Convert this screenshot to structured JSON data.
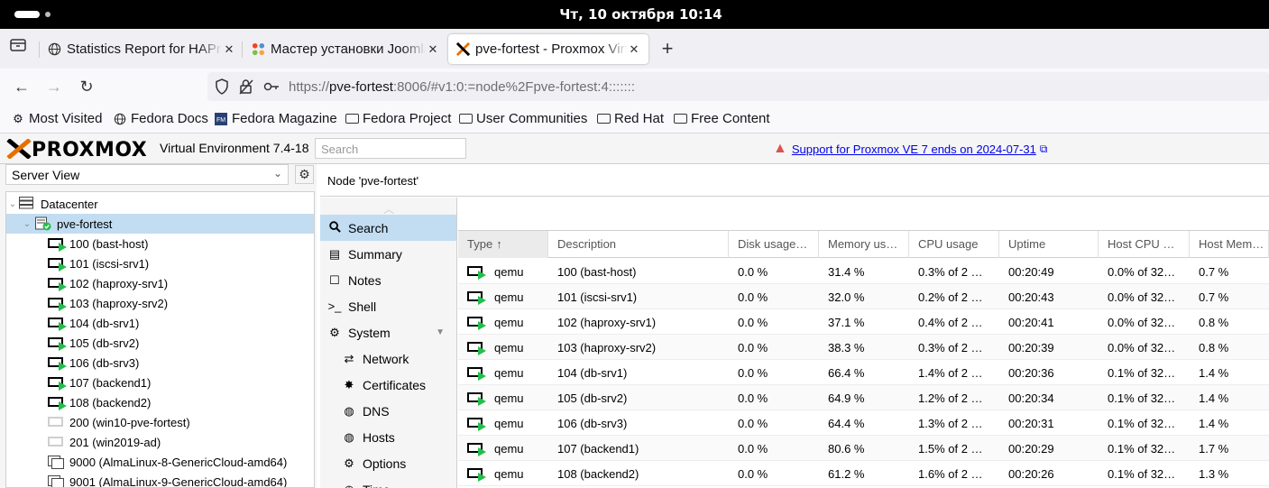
{
  "os": {
    "datetime": "Чт, 10 октября  10:14"
  },
  "browser": {
    "tabs": [
      {
        "title": "Statistics Report for HAProxy",
        "icon": "globe-icon"
      },
      {
        "title": "Мастер установки Joomla!",
        "icon": "joomla-icon"
      },
      {
        "title": "pve-fortest - Proxmox Virtual Environment",
        "icon": "proxmox-icon",
        "active": true
      }
    ],
    "url_prefix": "https://",
    "url_host": "pve-fortest",
    "url_rest": ":8006/#v1:0:=node%2Fpve-fortest:4:::::::",
    "bookmarks": [
      {
        "label": "Most Visited",
        "icon": "gear-icon"
      },
      {
        "label": "Fedora Docs",
        "icon": "globe-icon"
      },
      {
        "label": "Fedora Magazine",
        "icon": "fedora-magazine-icon"
      },
      {
        "label": "Fedora Project",
        "icon": "folder-icon"
      },
      {
        "label": "User Communities",
        "icon": "folder-icon"
      },
      {
        "label": "Red Hat",
        "icon": "folder-icon"
      },
      {
        "label": "Free Content",
        "icon": "folder-icon"
      }
    ]
  },
  "pve": {
    "logo": "PROXMOX",
    "version": "Virtual Environment 7.4-18",
    "search_placeholder": "Search",
    "warning": "Support for Proxmox VE 7 ends on 2024-07-31",
    "view_selector": "Server View",
    "tree": {
      "datacenter": "Datacenter",
      "node": "pve-fortest",
      "vms": [
        {
          "label": "100 (bast-host)",
          "state": "running"
        },
        {
          "label": "101 (iscsi-srv1)",
          "state": "running"
        },
        {
          "label": "102 (haproxy-srv1)",
          "state": "running"
        },
        {
          "label": "103 (haproxy-srv2)",
          "state": "running"
        },
        {
          "label": "104 (db-srv1)",
          "state": "running"
        },
        {
          "label": "105 (db-srv2)",
          "state": "running"
        },
        {
          "label": "106 (db-srv3)",
          "state": "running"
        },
        {
          "label": "107 (backend1)",
          "state": "running"
        },
        {
          "label": "108 (backend2)",
          "state": "running"
        },
        {
          "label": "200 (win10-pve-fortest)",
          "state": "stopped"
        },
        {
          "label": "201 (win2019-ad)",
          "state": "stopped"
        },
        {
          "label": "9000 (AlmaLinux-8-GenericCloud-amd64)",
          "state": "template"
        },
        {
          "label": "9001 (AlmaLinux-9-GenericCloud-amd64)",
          "state": "template"
        }
      ]
    },
    "content_title": "Node 'pve-fortest'",
    "menu": [
      {
        "label": "Search",
        "icon": "search-icon",
        "level": "top",
        "selected": true
      },
      {
        "label": "Summary",
        "icon": "summary-icon",
        "level": "top"
      },
      {
        "label": "Notes",
        "icon": "notes-icon",
        "level": "top"
      },
      {
        "label": "Shell",
        "icon": "terminal-icon",
        "level": "top"
      },
      {
        "label": "System",
        "icon": "cogs-icon",
        "level": "top",
        "expandable": true
      },
      {
        "label": "Network",
        "icon": "network-icon",
        "level": "sub"
      },
      {
        "label": "Certificates",
        "icon": "certificate-icon",
        "level": "sub"
      },
      {
        "label": "DNS",
        "icon": "globe-icon",
        "level": "sub"
      },
      {
        "label": "Hosts",
        "icon": "globe-icon",
        "level": "sub"
      },
      {
        "label": "Options",
        "icon": "gear-icon",
        "level": "sub"
      },
      {
        "label": "Time",
        "icon": "clock-icon",
        "level": "sub"
      }
    ],
    "grid": {
      "columns": [
        "Type",
        "Description",
        "Disk usage…",
        "Memory us…",
        "CPU usage",
        "Uptime",
        "Host CPU …",
        "Host Mem…"
      ],
      "sort_arrow": "↑",
      "rows": [
        [
          "qemu",
          "100 (bast-host)",
          "0.0 %",
          "31.4 %",
          "0.3% of 2 …",
          "00:20:49",
          "0.0% of 32…",
          "0.7 %"
        ],
        [
          "qemu",
          "101 (iscsi-srv1)",
          "0.0 %",
          "32.0 %",
          "0.2% of 2 …",
          "00:20:43",
          "0.0% of 32…",
          "0.7 %"
        ],
        [
          "qemu",
          "102 (haproxy-srv1)",
          "0.0 %",
          "37.1 %",
          "0.4% of 2 …",
          "00:20:41",
          "0.0% of 32…",
          "0.8 %"
        ],
        [
          "qemu",
          "103 (haproxy-srv2)",
          "0.0 %",
          "38.3 %",
          "0.3% of 2 …",
          "00:20:39",
          "0.0% of 32…",
          "0.8 %"
        ],
        [
          "qemu",
          "104 (db-srv1)",
          "0.0 %",
          "66.4 %",
          "1.4% of 2 …",
          "00:20:36",
          "0.1% of 32…",
          "1.4 %"
        ],
        [
          "qemu",
          "105 (db-srv2)",
          "0.0 %",
          "64.9 %",
          "1.2% of 2 …",
          "00:20:34",
          "0.1% of 32…",
          "1.4 %"
        ],
        [
          "qemu",
          "106 (db-srv3)",
          "0.0 %",
          "64.4 %",
          "1.3% of 2 …",
          "00:20:31",
          "0.1% of 32…",
          "1.4 %"
        ],
        [
          "qemu",
          "107 (backend1)",
          "0.0 %",
          "80.6 %",
          "1.5% of 2 …",
          "00:20:29",
          "0.1% of 32…",
          "1.7 %"
        ],
        [
          "qemu",
          "108 (backend2)",
          "0.0 %",
          "61.2 %",
          "1.6% of 2 …",
          "00:20:26",
          "0.1% of 32…",
          "1.3 %"
        ]
      ]
    }
  }
}
